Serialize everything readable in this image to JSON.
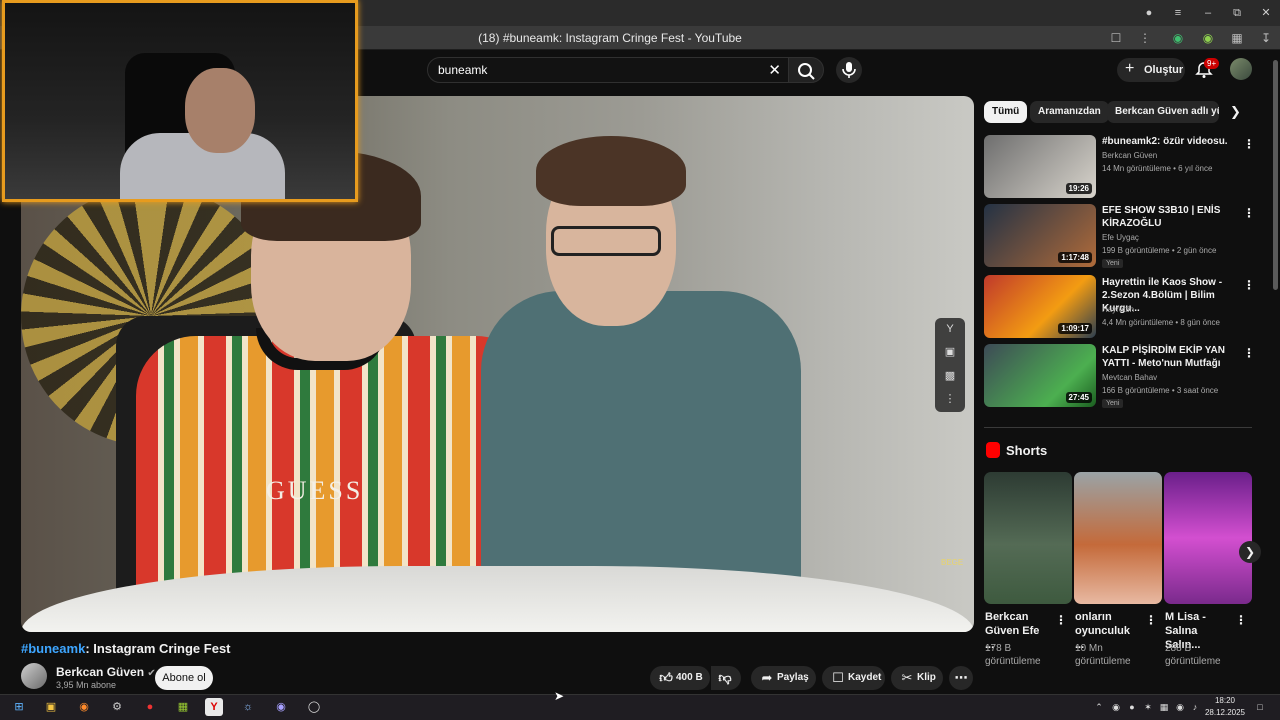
{
  "browser": {
    "tab_title": "(18) #buneamk: Instagram Cringe Fest - YouTube",
    "icons": [
      "account-icon",
      "menu-icon",
      "minimize-icon",
      "restore-icon",
      "close-icon"
    ]
  },
  "header": {
    "search_value": "buneamk",
    "create_label": "Oluştur",
    "notification_count": "9+"
  },
  "video": {
    "title_hashtag": "#buneamk",
    "title_rest": ": Instagram Cringe Fest",
    "shirt_text": "GUESS",
    "watermark": "BEGE"
  },
  "channel": {
    "name": "Berkcan Güven",
    "subscribers": "3,95 Mn abone",
    "subscribe_label": "Abone ol"
  },
  "actions": {
    "likes": "400 B",
    "share": "Paylaş",
    "save": "Kaydet",
    "clip": "Klip"
  },
  "chips": [
    "Tümü",
    "Aramanızdan",
    "Berkcan Güven adlı yüklei"
  ],
  "recommendations": [
    {
      "title": "#buneamk2: özür videosu.",
      "channel": "Berkcan Güven",
      "meta": "14 Mn görüntüleme • 6 yıl önce",
      "duration": "19:26",
      "badge": ""
    },
    {
      "title": "EFE SHOW S3B10 | ENİS KİRAZOĞLU",
      "channel": "Efe Uygaç",
      "meta": "199 B görüntüleme • 2 gün önce",
      "duration": "1:17:48",
      "badge": "Yeni"
    },
    {
      "title": "Hayrettin ile Kaos Show - 2.Sezon 4.Bölüm | Bilim Kurgu...",
      "channel": "Hayrettin",
      "meta": "4,4 Mn görüntüleme • 8 gün önce",
      "duration": "1:09:17",
      "badge": ""
    },
    {
      "title": "KALP PİŞİRDİM EKİP YAN YATTI - Meto'nun Mutfağı",
      "channel": "Mevtcan Bahav",
      "meta": "166 B görüntüleme • 3 saat önce",
      "duration": "27:45",
      "badge": "Yeni"
    }
  ],
  "shorts": {
    "heading": "Shorts",
    "items": [
      {
        "title": "Berkcan Güven Efe ...",
        "views": "178 B görüntüleme"
      },
      {
        "title": "onların oyunculuk ...",
        "views": "10 Mn görüntüleme"
      },
      {
        "title": "M Lisa - Salına Salın...",
        "views": "288 B görüntüleme"
      }
    ]
  },
  "taskbar": {
    "time": "18:20",
    "date": "28.12.2025"
  },
  "colors": {
    "background": "#0f0f0f",
    "link": "#3ea6ff",
    "webcam_border": "#e79b1e",
    "youtube_red": "#ff0000"
  }
}
